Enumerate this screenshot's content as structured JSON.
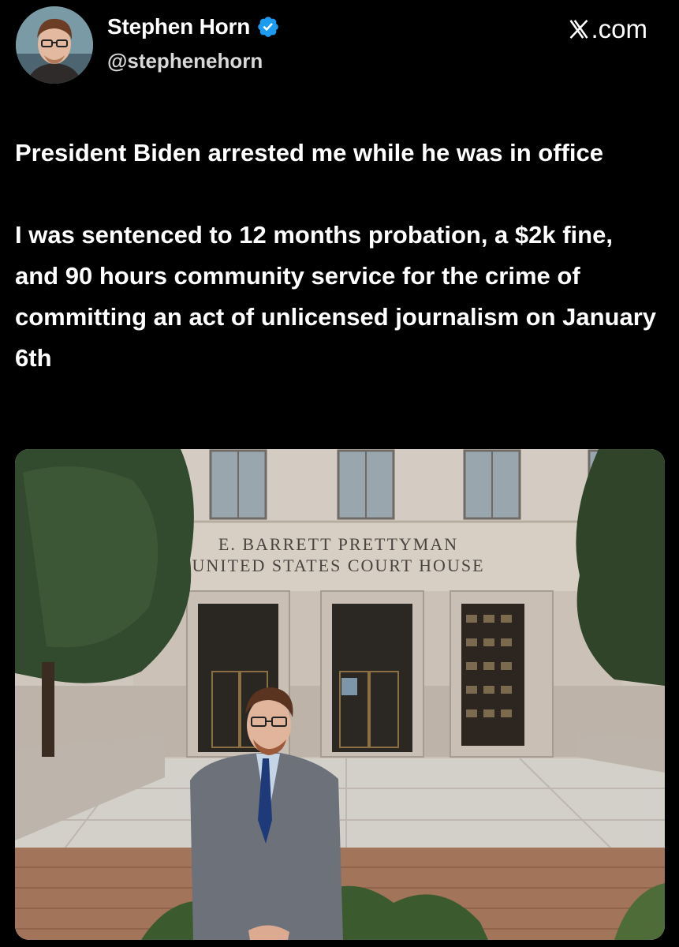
{
  "header": {
    "display_name": "Stephen Horn",
    "handle": "@stephenehorn",
    "site_label": ".com",
    "site_icon": "x-logo-icon",
    "verified_icon": "verified-badge-icon",
    "verified_color": "#1d9bf0"
  },
  "post": {
    "paragraph_1": "President Biden arrested me while he was in office",
    "paragraph_2": "I was sentenced to 12 months probation, a $2k fine, and 90 hours community service for the crime of committing an act of unlicensed journalism on January 6th"
  },
  "photo": {
    "inscription_line_1": "E. BARRETT PRETTYMAN",
    "inscription_line_2": "UNITED STATES COURT HOUSE"
  }
}
